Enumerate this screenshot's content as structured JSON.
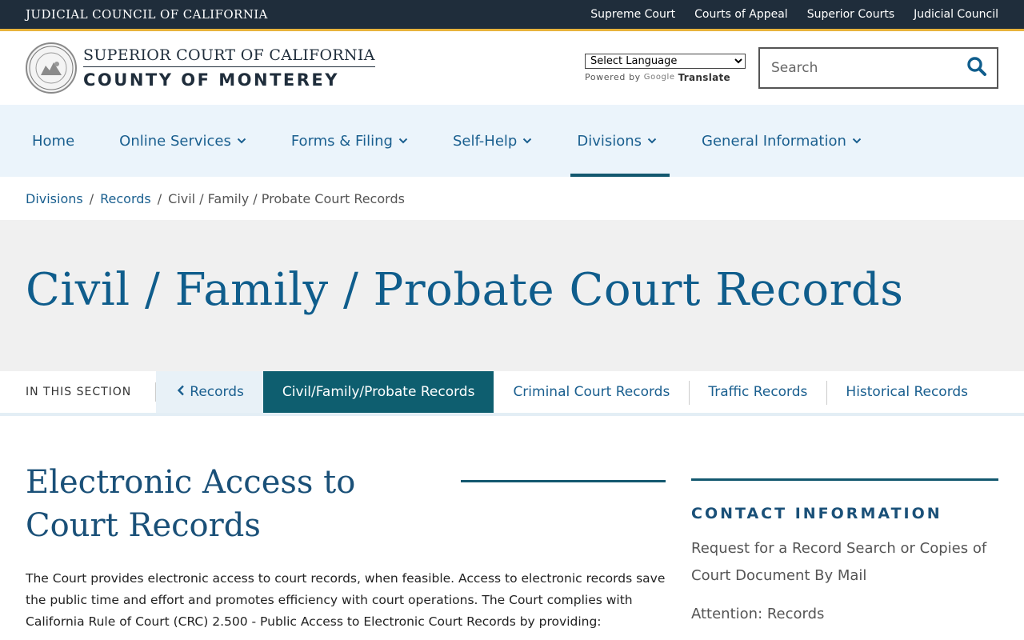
{
  "topbar": {
    "agency": "JUDICIAL COUNCIL OF CALIFORNIA",
    "links": [
      "Supreme Court",
      "Courts of Appeal",
      "Superior Courts",
      "Judicial Council"
    ]
  },
  "header": {
    "brand_line1": "SUPERIOR COURT OF CALIFORNIA",
    "brand_line2": "COUNTY OF MONTEREY",
    "language_select": "Select Language",
    "powered_by": "Powered by",
    "google": "Google",
    "translate": "Translate",
    "search_placeholder": "Search"
  },
  "nav": {
    "items": [
      {
        "label": "Home"
      },
      {
        "label": "Online Services"
      },
      {
        "label": "Forms & Filing"
      },
      {
        "label": "Self-Help"
      },
      {
        "label": "Divisions"
      },
      {
        "label": "General Information"
      }
    ]
  },
  "breadcrumb": {
    "items": [
      "Divisions",
      "Records"
    ],
    "separator": "/",
    "current": "Civil / Family / Probate Court Records"
  },
  "hero": {
    "title": "Civil / Family / Probate Court Records"
  },
  "section_nav": {
    "label": "IN THIS SECTION",
    "back": "Records",
    "active": "Civil/Family/Probate Records",
    "links": [
      "Criminal Court Records",
      "Traffic Records",
      "Historical Records"
    ]
  },
  "content": {
    "heading": "Electronic Access to Court Records",
    "paragraph": "The Court provides electronic access to court records, when feasible. Access to electronic records save the public time and effort and promotes efficiency with court operations. The Court complies with California Rule of Court (CRC) 2.500 - Public Access to Electronic Court Records by providing:"
  },
  "contact": {
    "title": "CONTACT INFORMATION",
    "text": "Request for a Record Search or Copies of Court Document By Mail",
    "attention": "Attention: Records"
  },
  "colors": {
    "topbar": "#1f2d3b",
    "accent": "#e8b33b",
    "link": "#1a5f8f",
    "active_tab": "#0e5e6f"
  }
}
